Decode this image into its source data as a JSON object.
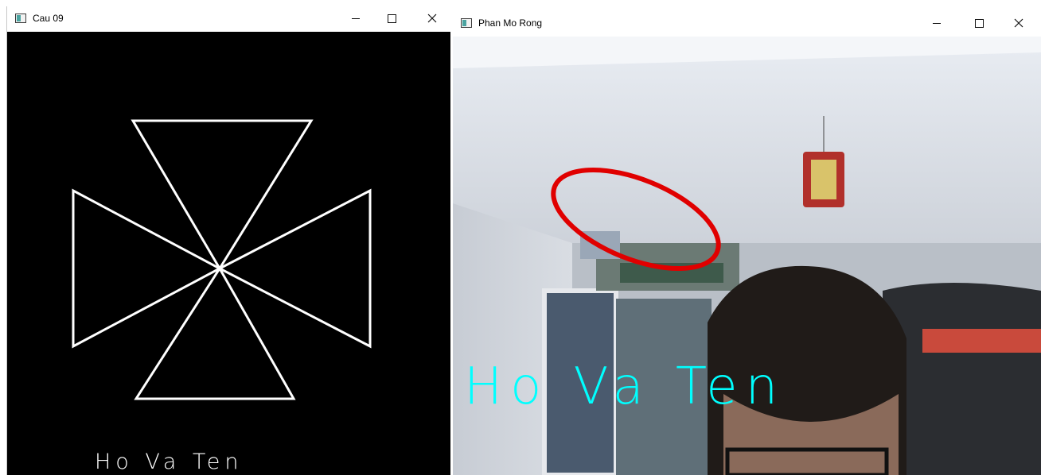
{
  "windows": [
    {
      "title": "Cau 09",
      "overlay_text": "Ho Va Ten"
    },
    {
      "title": "Phan Mo Rong",
      "overlay_text": "Ho Va Ten"
    }
  ],
  "colors": {
    "canvas_black": "#000000",
    "shape_stroke": "#ffffff",
    "ellipse_red": "#e00000",
    "text_cyan": "#00ffff"
  },
  "icons": {
    "app": "window-app-icon",
    "minimize": "minimize-icon",
    "maximize": "maximize-icon",
    "close": "close-icon"
  }
}
